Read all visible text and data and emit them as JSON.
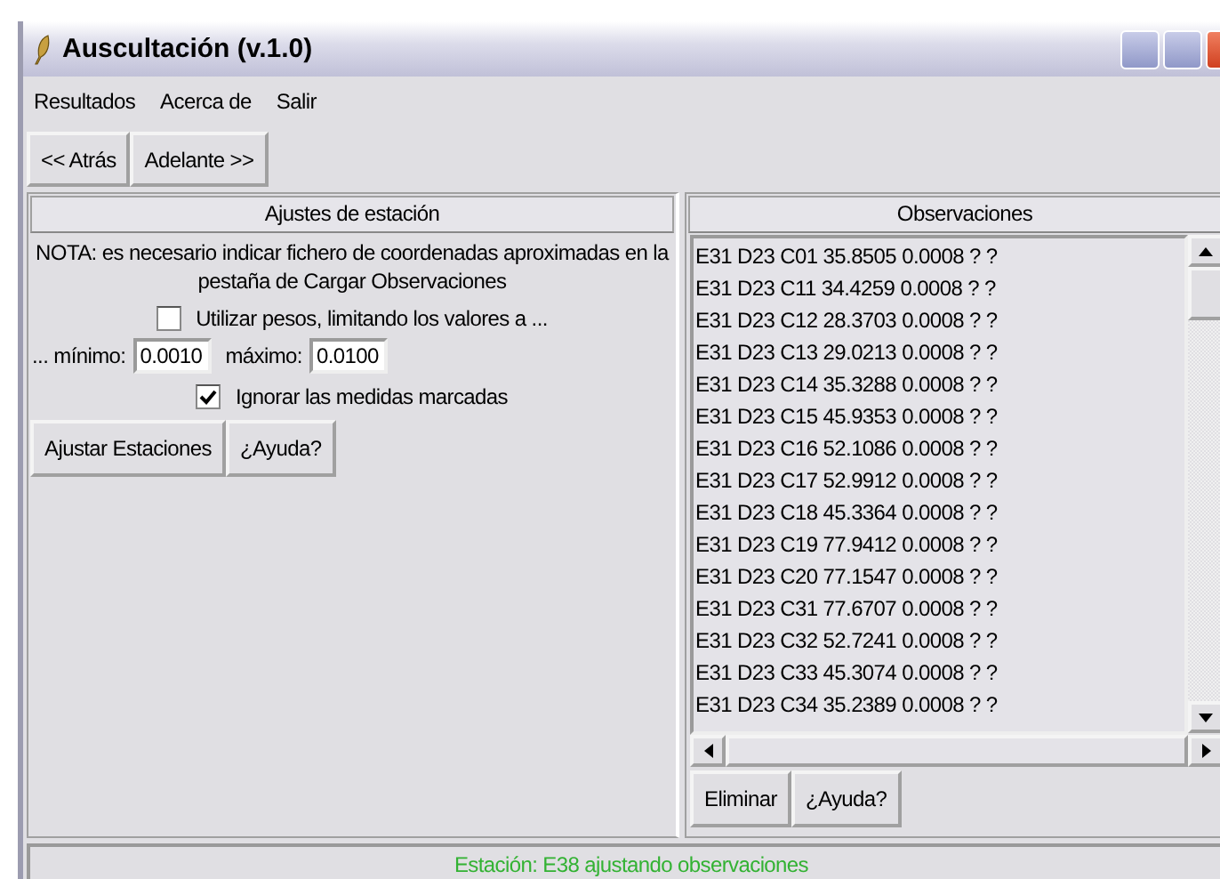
{
  "window": {
    "title": "Auscultación (v.1.0)"
  },
  "menu": [
    "Resultados",
    "Acerca de",
    "Salir"
  ],
  "nav_buttons": [
    "<< Atrás",
    "Adelante >>"
  ],
  "station_panel": {
    "title": "Ajustes de estación",
    "note": "NOTA: es necesario indicar fichero de coordenadas aproximadas en la pestaña de Cargar Observaciones",
    "use_weights": {
      "label": "Utilizar pesos, limitando los valores a ...",
      "checked": false
    },
    "limits_label": "... mínimo:",
    "min": "0.0010",
    "max_label": "máximo:",
    "max": "0.0100",
    "ignore_marked": {
      "label": "Ignorar las medidas marcadas",
      "checked": true
    },
    "buttons": [
      "Ajustar Estaciones",
      "¿Ayuda?"
    ]
  },
  "observations_panel": {
    "title": "Observaciones",
    "rows": [
      "E31 D23 C01 35.8505 0.0008 ? ?",
      "E31 D23 C11 34.4259 0.0008 ? ?",
      "E31 D23 C12 28.3703 0.0008 ? ?",
      "E31 D23 C13 29.0213 0.0008 ? ?",
      "E31 D23 C14 35.3288 0.0008 ? ?",
      "E31 D23 C15 45.9353 0.0008 ? ?",
      "E31 D23 C16 52.1086 0.0008 ? ?",
      "E31 D23 C17 52.9912 0.0008 ? ?",
      "E31 D23 C18 45.3364 0.0008 ? ?",
      "E31 D23 C19 77.9412 0.0008 ? ?",
      "E31 D23 C20 77.1547 0.0008 ? ?",
      "E31 D23 C31 77.6707 0.0008 ? ?",
      "E31 D23 C32 52.7241 0.0008 ? ?",
      "E31 D23 C33 45.3074 0.0008 ? ?",
      "E31 D23 C34 35.2389 0.0008 ? ?"
    ],
    "buttons": [
      "Eliminar",
      "¿Ayuda?"
    ]
  },
  "status_bar": "Estación: E38 ajustando observaciones"
}
